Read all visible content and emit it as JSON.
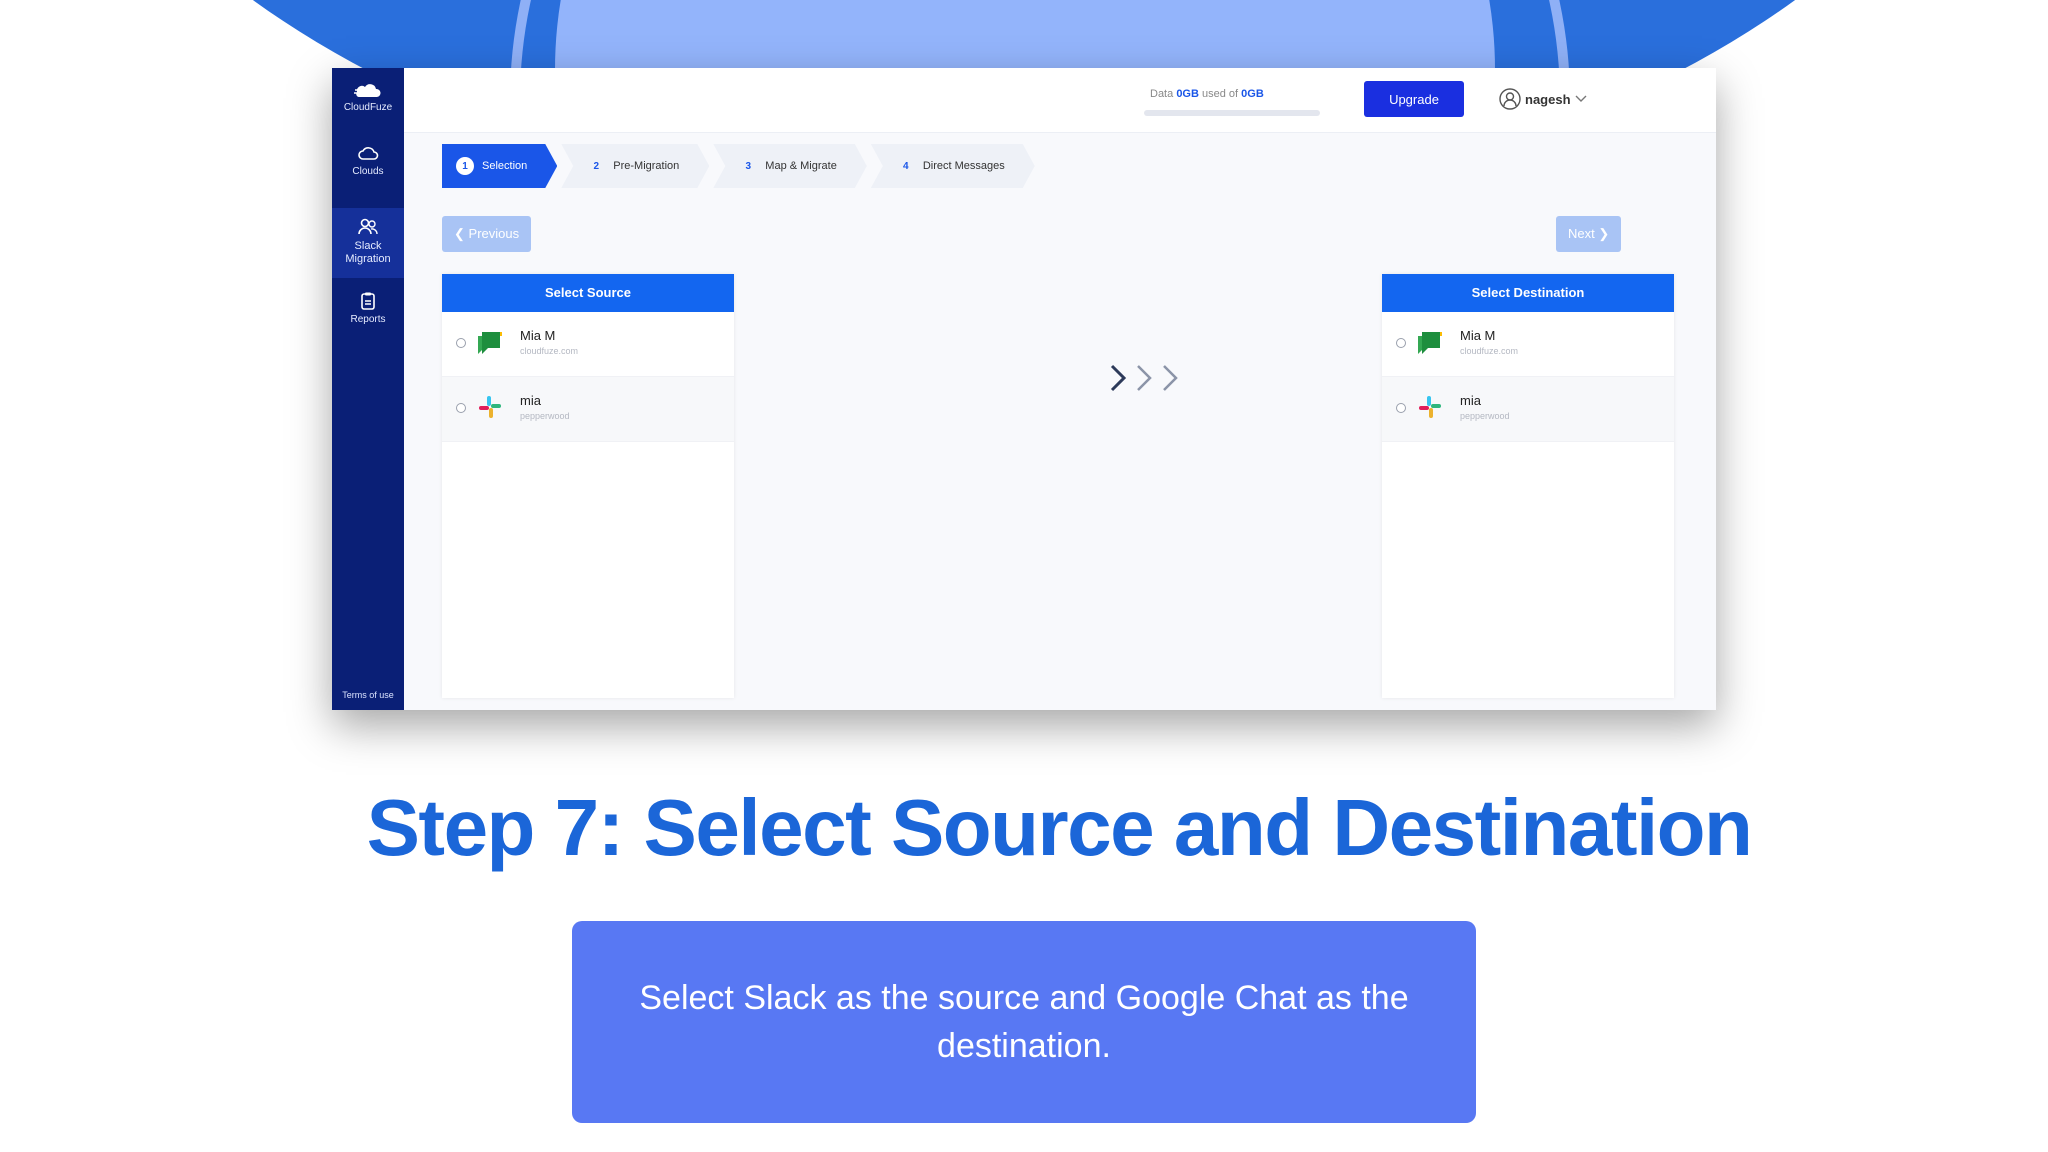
{
  "app": {
    "brand": "CloudFuze",
    "sidebar": {
      "items": [
        {
          "label": "Clouds",
          "icon": "cloud-icon"
        },
        {
          "label": "Slack Migration",
          "icon": "users-icon",
          "active": true
        },
        {
          "label": "Reports",
          "icon": "report-icon"
        }
      ],
      "footer": "Terms of use"
    },
    "topbar": {
      "data_prefix": "Data",
      "data_used": "0GB",
      "data_mid": "used of",
      "data_total": "0GB",
      "usage_fraction": 0,
      "upgrade_label": "Upgrade",
      "user_name": "nagesh"
    },
    "steps": [
      {
        "num": "1",
        "label": "Selection",
        "active": true
      },
      {
        "num": "2",
        "label": "Pre-Migration"
      },
      {
        "num": "3",
        "label": "Map & Migrate"
      },
      {
        "num": "4",
        "label": "Direct Messages"
      }
    ],
    "previous_label": "Previous",
    "next_label": "Next",
    "source": {
      "header": "Select Source",
      "accounts": [
        {
          "name": "Mia M",
          "sub": "cloudfuze.com",
          "icon": "google-chat-icon"
        },
        {
          "name": "mia",
          "sub": "pepperwood",
          "icon": "slack-icon"
        }
      ]
    },
    "destination": {
      "header": "Select Destination",
      "accounts": [
        {
          "name": "Mia M",
          "sub": "cloudfuze.com",
          "icon": "google-chat-icon"
        },
        {
          "name": "mia",
          "sub": "pepperwood",
          "icon": "slack-icon"
        }
      ]
    }
  },
  "caption": {
    "title": "Step 7: Select Source and Destination",
    "text": "Select Slack as the source and Google Chat as the destination."
  },
  "colors": {
    "accent": "#1a56e8",
    "sidebar": "#0a1f76",
    "title": "#1b66d8",
    "note_bg": "#5878f3"
  }
}
